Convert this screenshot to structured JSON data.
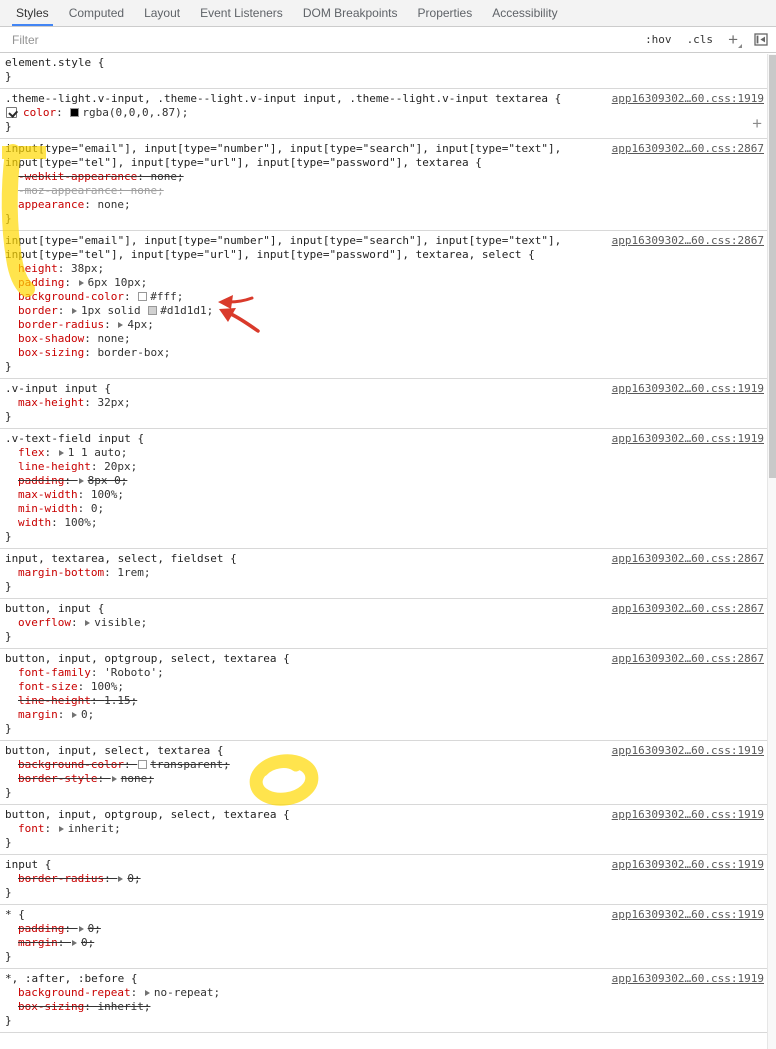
{
  "tabs": {
    "active_index": 0,
    "items": [
      {
        "label": "Styles"
      },
      {
        "label": "Computed"
      },
      {
        "label": "Layout"
      },
      {
        "label": "Event Listeners"
      },
      {
        "label": "DOM Breakpoints"
      },
      {
        "label": "Properties"
      },
      {
        "label": "Accessibility"
      }
    ]
  },
  "toolbar": {
    "filter_placeholder": "Filter",
    "hov_label": ":hov",
    "cls_label": ".cls",
    "plus_label": "+"
  },
  "glyphs": {
    "close_brace": "}",
    "colon": ": ",
    "semicolon": ";"
  },
  "colors": {
    "tab_accent": "#4285f4",
    "property_name": "#c80000",
    "link": "#595959",
    "highlighter": "#ffd900",
    "pen": "#d93a2b"
  },
  "rules": [
    {
      "selector_lines": [
        "element.style {"
      ],
      "link": "",
      "properties": []
    },
    {
      "selector_lines": [
        ".theme--light.v-input, .theme--light.v-input input, .theme--light.v-input textarea {"
      ],
      "link": "app16309302…60.css:1919",
      "plus_button": true,
      "properties": [
        {
          "checkbox": true,
          "name": "color",
          "swatch": "#000000",
          "value": "rgba(0,0,0,.87)"
        }
      ]
    },
    {
      "selector_lines": [
        "input[type=\"email\"], input[type=\"number\"], input[type=\"search\"], input[type=\"text\"],",
        "input[type=\"tel\"], input[type=\"url\"], input[type=\"password\"], textarea {"
      ],
      "link": "app16309302…60.css:2867",
      "properties": [
        {
          "name": "-webkit-appearance",
          "value": "none",
          "struck": true
        },
        {
          "name": "-moz-appearance",
          "value": "none",
          "struck": true,
          "faded": true
        },
        {
          "name": "appearance",
          "value": "none"
        }
      ]
    },
    {
      "selector_lines": [
        "input[type=\"email\"], input[type=\"number\"], input[type=\"search\"], input[type=\"text\"],",
        "input[type=\"tel\"], input[type=\"url\"], input[type=\"password\"], textarea, select {"
      ],
      "link": "app16309302…60.css:2867",
      "properties": [
        {
          "name": "height",
          "value": "38px"
        },
        {
          "name": "padding",
          "arrow": true,
          "value": "6px 10px"
        },
        {
          "name": "background-color",
          "swatch": "#ffffff",
          "value": "#fff"
        },
        {
          "name": "border",
          "arrow": true,
          "pre": "1px solid ",
          "swatch": "#d1d1d1",
          "value": "#d1d1d1"
        },
        {
          "name": "border-radius",
          "arrow": true,
          "value": "4px"
        },
        {
          "name": "box-shadow",
          "value": "none"
        },
        {
          "name": "box-sizing",
          "value": "border-box"
        }
      ]
    },
    {
      "selector_lines": [
        ".v-input input {"
      ],
      "link": "app16309302…60.css:1919",
      "properties": [
        {
          "name": "max-height",
          "value": "32px"
        }
      ]
    },
    {
      "selector_lines": [
        ".v-text-field input {"
      ],
      "link": "app16309302…60.css:1919",
      "properties": [
        {
          "name": "flex",
          "arrow": true,
          "value": "1 1 auto"
        },
        {
          "name": "line-height",
          "value": "20px"
        },
        {
          "name": "padding",
          "arrow": true,
          "value": "8px 0",
          "struck": true
        },
        {
          "name": "max-width",
          "value": "100%"
        },
        {
          "name": "min-width",
          "value": "0"
        },
        {
          "name": "width",
          "value": "100%"
        }
      ]
    },
    {
      "selector_lines": [
        "input, textarea, select, fieldset {"
      ],
      "link": "app16309302…60.css:2867",
      "properties": [
        {
          "name": "margin-bottom",
          "value": "1rem"
        }
      ]
    },
    {
      "selector_lines": [
        "button, input {"
      ],
      "link": "app16309302…60.css:2867",
      "properties": [
        {
          "name": "overflow",
          "arrow": true,
          "value": "visible"
        }
      ]
    },
    {
      "selector_lines": [
        "button, input, optgroup, select, textarea {"
      ],
      "link": "app16309302…60.css:2867",
      "properties": [
        {
          "name": "font-family",
          "value": "'Roboto'"
        },
        {
          "name": "font-size",
          "value": "100%"
        },
        {
          "name": "line-height",
          "value": "1.15",
          "struck": true
        },
        {
          "name": "margin",
          "arrow": true,
          "value": "0"
        }
      ]
    },
    {
      "selector_lines": [
        "button, input, select, textarea {"
      ],
      "link": "app16309302…60.css:1919",
      "properties": [
        {
          "name": "background-color",
          "swatch": "#ffffff",
          "value": "transparent",
          "struck": true
        },
        {
          "name": "border-style",
          "arrow": true,
          "value": "none",
          "struck": true
        }
      ]
    },
    {
      "selector_lines": [
        "button, input, optgroup, select, textarea {"
      ],
      "link": "app16309302…60.css:1919",
      "properties": [
        {
          "name": "font",
          "arrow": true,
          "value": "inherit"
        }
      ]
    },
    {
      "selector_lines": [
        "input {"
      ],
      "link": "app16309302…60.css:1919",
      "properties": [
        {
          "name": "border-radius",
          "arrow": true,
          "value": "0",
          "struck": true
        }
      ]
    },
    {
      "selector_lines": [
        "* {"
      ],
      "link": "app16309302…60.css:1919",
      "properties": [
        {
          "name": "padding",
          "arrow": true,
          "value": "0",
          "struck": true
        },
        {
          "name": "margin",
          "arrow": true,
          "value": "0",
          "struck": true
        }
      ]
    },
    {
      "selector_lines": [
        "*, :after, :before {"
      ],
      "link": "app16309302…60.css:1919",
      "properties": [
        {
          "name": "background-repeat",
          "arrow": true,
          "value": "no-repeat"
        },
        {
          "name": "box-sizing",
          "value": "inherit",
          "struck": true
        }
      ]
    }
  ]
}
